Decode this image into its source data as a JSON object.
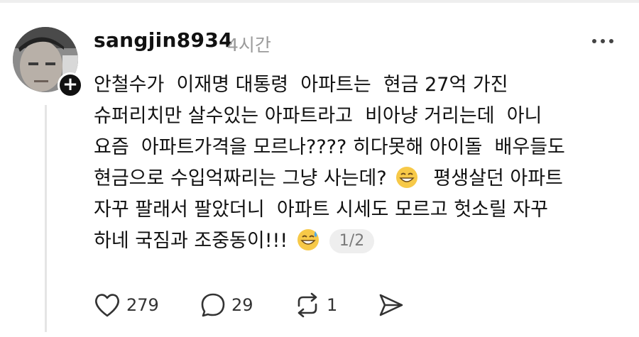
{
  "post": {
    "username": "sangjin8934",
    "timestamp": "4시간",
    "lines": [
      "안철수가  이재명 대통령  아파트는  현금 27억 가진",
      "슈퍼리치만 살수있는 아파트라고  비아냥 거리는데  아니",
      "요즘  아파트가격을 모르나???? 히다못해 아이돌  배우들도",
      "현금으로 수입억짜리는 그냥 사는데? ",
      "  평생살던 아파트",
      "자꾸 팔래서 팔았더니  아파트 시세도 모르고 헛소릴 자꾸",
      "하네 국짐과 조중동이!!! "
    ],
    "pagination": "1/2"
  },
  "actions": {
    "likes": "279",
    "comments": "29",
    "reposts": "1"
  },
  "icons": {
    "follow": "plus-icon",
    "more": "more-dots-icon",
    "like": "heart-icon",
    "comment": "speech-bubble-icon",
    "repost": "repost-icon",
    "share": "send-icon",
    "emoji1": "grinning-emoji",
    "emoji2": "sweat-smile-emoji"
  },
  "colors": {
    "text": "#111111",
    "muted": "#9b9b9b",
    "pill_bg": "#eeeeee",
    "emoji_yellow": "#f7c948"
  }
}
